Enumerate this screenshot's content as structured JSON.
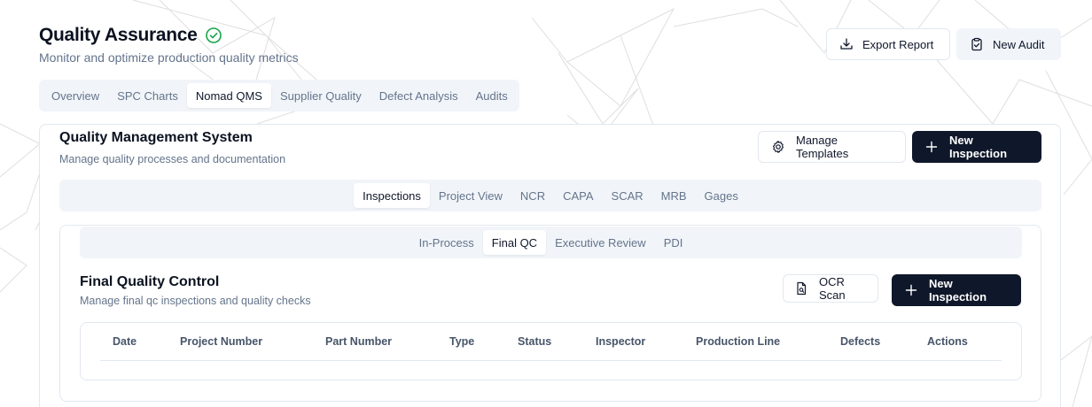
{
  "header": {
    "title": "Quality Assurance",
    "subtitle": "Monitor and optimize production quality metrics",
    "export_label": "Export Report",
    "new_audit_label": "New Audit"
  },
  "main_tabs": [
    {
      "label": "Overview",
      "active": false
    },
    {
      "label": "SPC Charts",
      "active": false
    },
    {
      "label": "Nomad QMS",
      "active": true
    },
    {
      "label": "Supplier Quality",
      "active": false
    },
    {
      "label": "Defect Analysis",
      "active": false
    },
    {
      "label": "Audits",
      "active": false
    }
  ],
  "qms": {
    "title": "Quality Management System",
    "subtitle": "Manage quality processes and documentation",
    "manage_templates_label": "Manage Templates",
    "new_inspection_label": "New Inspection",
    "tabs": [
      {
        "label": "Inspections",
        "active": true
      },
      {
        "label": "Project View",
        "active": false
      },
      {
        "label": "NCR",
        "active": false
      },
      {
        "label": "CAPA",
        "active": false
      },
      {
        "label": "SCAR",
        "active": false
      },
      {
        "label": "MRB",
        "active": false
      },
      {
        "label": "Gages",
        "active": false
      }
    ]
  },
  "inspections": {
    "tabs": [
      {
        "label": "In-Process",
        "active": false
      },
      {
        "label": "Final QC",
        "active": true
      },
      {
        "label": "Executive Review",
        "active": false
      },
      {
        "label": "PDI",
        "active": false
      }
    ],
    "title": "Final Quality Control",
    "subtitle": "Manage final qc inspections and quality checks",
    "ocr_label": "OCR Scan",
    "new_inspection_label": "New Inspection",
    "columns": [
      "Date",
      "Project Number",
      "Part Number",
      "Type",
      "Status",
      "Inspector",
      "Production Line",
      "Defects",
      "Actions"
    ]
  },
  "colors": {
    "primary_dark": "#0f172a",
    "muted_text": "#64748b",
    "success": "#16a34a",
    "tab_bg": "#f1f5f9",
    "border": "#e2e8f0"
  },
  "icons": {
    "title_status": "check-circle-icon",
    "export": "download-tray-icon",
    "new_audit": "clipboard-check-icon",
    "manage_templates": "gear-icon",
    "new_inspection": "plus-icon",
    "ocr_scan": "file-scan-icon"
  }
}
